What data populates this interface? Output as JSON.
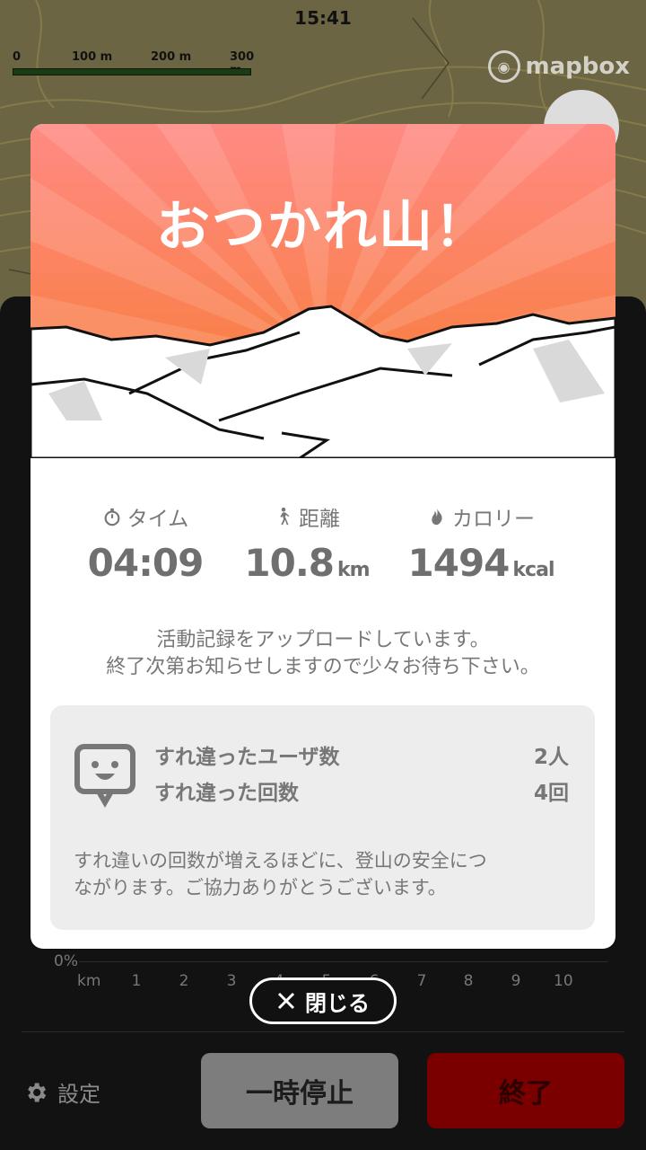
{
  "status": {
    "time": "15:41"
  },
  "map": {
    "scale_labels": [
      "0",
      "100 m",
      "200 m",
      "300 m"
    ],
    "attribution": "mapbox"
  },
  "modal": {
    "title": "おつかれ山！",
    "stats": [
      {
        "icon": "stopwatch-icon",
        "label": "タイム",
        "value": "04:09",
        "unit": ""
      },
      {
        "icon": "hiker-icon",
        "label": "距離",
        "value": "10.8",
        "unit": "km"
      },
      {
        "icon": "flame-icon",
        "label": "カロリー",
        "value": "1494",
        "unit": "kcal"
      }
    ],
    "upload_line1": "活動記録をアップロードしています。",
    "upload_line2": "終了次第お知らせしますので少々お待ち下さい。",
    "encounter": {
      "users_label": "すれ違ったユーザ数",
      "users_value": "2人",
      "count_label": "すれ違った回数",
      "count_value": "4回",
      "note_line1": "すれ違いの回数が増えるほどに、登山の安全につ",
      "note_line2": "ながります。ご協力ありがとうございます。"
    }
  },
  "chart_axis": {
    "y_zero": "0%",
    "x_unit": "km",
    "x_ticks": [
      "1",
      "2",
      "3",
      "4",
      "5",
      "6",
      "7",
      "8",
      "9",
      "10"
    ]
  },
  "close_button": {
    "label": "閉じる"
  },
  "bottom_bar": {
    "settings_label": "設定",
    "pause_label": "一時停止",
    "end_label": "終了"
  },
  "colors": {
    "sunset_top": "#ff8a84",
    "sunset_bottom": "#f77b2d",
    "end_button": "#7a0000"
  }
}
